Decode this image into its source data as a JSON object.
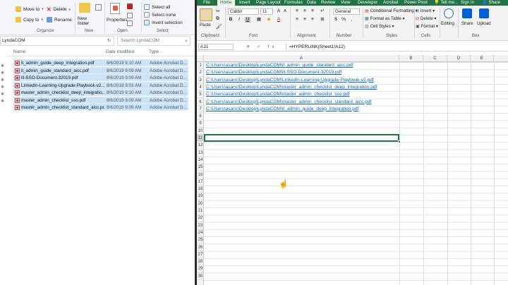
{
  "explorer": {
    "ribbon": {
      "move_to": "Move to",
      "copy_to": "Copy to",
      "delete": "Delete",
      "rename": "Rename",
      "new_folder": "New\nfolder",
      "properties": "Properties",
      "select_all": "Select all",
      "select_none": "Select none",
      "invert_selection": "Invert selection",
      "groups": {
        "organize": "Organize",
        "new": "New",
        "open": "Open",
        "select": "Select"
      }
    },
    "address": "LyndaCOM",
    "search_placeholder": "Search LyndaCOM",
    "columns": {
      "name": "Name",
      "date": "Date modified",
      "type": "Type"
    },
    "files": [
      {
        "name": "it_admin_guide_deep_integration.pdf",
        "date": "8/6/2019 9:10 AM",
        "type": "Adobe Acrobat D..."
      },
      {
        "name": "it_admin_guide_standard_aicc.pdf",
        "date": "8/6/2019 9:09 AM",
        "type": "Adobe Acrobat D..."
      },
      {
        "name": "lil-SSO-Document-32019.pdf",
        "date": "8/6/2019 9:09 AM",
        "type": "Adobe Acrobat D..."
      },
      {
        "name": "LinkedIn-Learning-Upgrade-Playbook-v2...",
        "date": "8/6/2019 9:03 AM",
        "type": "Adobe Acrobat D..."
      },
      {
        "name": "master_admin_checklist_deep_integratio...",
        "date": "8/6/2019 9:10 AM",
        "type": "Adobe Acrobat D..."
      },
      {
        "name": "master_admin_checklist_sso.pdf",
        "date": "8/6/2019 9:09 AM",
        "type": "Adobe Acrobat D..."
      },
      {
        "name": "master_admin_checklist_standard_aicc.pdf",
        "date": "8/6/2019 9:09 AM",
        "type": "Adobe Acrobat D..."
      }
    ]
  },
  "excel": {
    "tabs": [
      "File",
      "Home",
      "Insert",
      "Page Layout",
      "Formulas",
      "Data",
      "Review",
      "View",
      "Developer",
      "Acrobat",
      "Power Pivot"
    ],
    "active_tab": "Home",
    "tell_me": "Tell me...",
    "sign_in": "Sign in",
    "share_tab": "Share",
    "ribbon": {
      "paste": "Paste",
      "font_name": "Calibri",
      "font_size": "11",
      "number_format": "General",
      "conditional_formatting": "Conditional Formatting",
      "format_as_table": "Format as Table",
      "cell_styles": "Cell Styles",
      "insert": "Insert",
      "delete": "Delete",
      "format": "Format",
      "editing": "Editing",
      "share": "Share",
      "upload": "Upload",
      "groups": {
        "clipboard": "Clipboard",
        "font": "Font",
        "alignment": "Alignment",
        "number": "Number",
        "styles": "Styles",
        "cells": "Cells",
        "box": "Box"
      }
    },
    "name_box": "A11",
    "formula": "=HYPERLINK(Sheet1!A12)",
    "fx_tools": "✕ ✓ fx",
    "columns": [
      "A",
      "B",
      "C",
      "D",
      "E"
    ],
    "rows": [
      "1",
      "2",
      "3",
      "4",
      "5",
      "6",
      "7",
      "8",
      "9",
      "10",
      "11",
      "12",
      "13",
      "14",
      "15",
      "16",
      "17",
      "18",
      "19",
      "20",
      "21",
      "22",
      "23",
      "24",
      "25",
      "26",
      "27",
      "28",
      "29",
      "30"
    ],
    "selected_row": "11",
    "links": [
      "C:\\Users\\asanc\\Desktop\\LyndaCOM\\it_admin_guide_standard_aicc.pdf",
      "C:\\Users\\asanc\\Desktop\\LyndaCOM\\lil-SSO-Document-32019.pdf",
      "C:\\Users\\asanc\\Desktop\\LyndaCOM\\LinkedIn-Learning-Upgrade-Playbook-v2.pdf",
      "C:\\Users\\asanc\\Desktop\\LyndaCOM\\master_admin_checklist_deep_integration.pdf",
      "C:\\Users\\asanc\\Desktop\\LyndaCOM\\master_admin_checklist_sso.pdf",
      "C:\\Users\\asanc\\Desktop\\LyndaCOM\\master_admin_checklist_standard_aicc.pdf",
      "C:\\Users\\asanc\\Desktop\\LyndaCOM\\it_admin_guide_deep_integration.pdf"
    ]
  },
  "colors": {
    "excel_green": "#217346",
    "link_blue": "#0563c1",
    "selection_blue": "#cce4f7"
  }
}
